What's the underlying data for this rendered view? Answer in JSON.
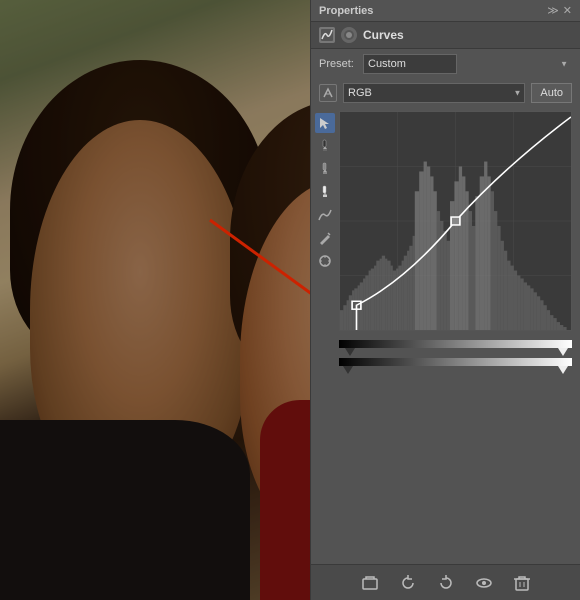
{
  "panel": {
    "title": "Properties",
    "section_title": "Curves",
    "preset_label": "Preset:",
    "preset_value": "Custom",
    "channel_value": "RGB",
    "auto_label": "Auto",
    "tools": [
      {
        "name": "select-tool",
        "icon": "↖",
        "active": true
      },
      {
        "name": "eyedropper-black",
        "icon": "✒",
        "active": false
      },
      {
        "name": "eyedropper-gray",
        "icon": "✒",
        "active": false
      },
      {
        "name": "eyedropper-white",
        "icon": "✒",
        "active": false
      },
      {
        "name": "smooth-tool",
        "icon": "〜",
        "active": false
      },
      {
        "name": "pencil-tool",
        "icon": "✏",
        "active": false
      },
      {
        "name": "target-tool",
        "icon": "✛",
        "active": false
      }
    ],
    "bottom_toolbar": [
      {
        "name": "clip-button",
        "icon": "⬛"
      },
      {
        "name": "undo-history",
        "icon": "↺"
      },
      {
        "name": "reset-button",
        "icon": "↩"
      },
      {
        "name": "visibility",
        "icon": "👁"
      },
      {
        "name": "delete-button",
        "icon": "🗑"
      }
    ]
  },
  "arrow": {
    "color": "#cc2200"
  }
}
